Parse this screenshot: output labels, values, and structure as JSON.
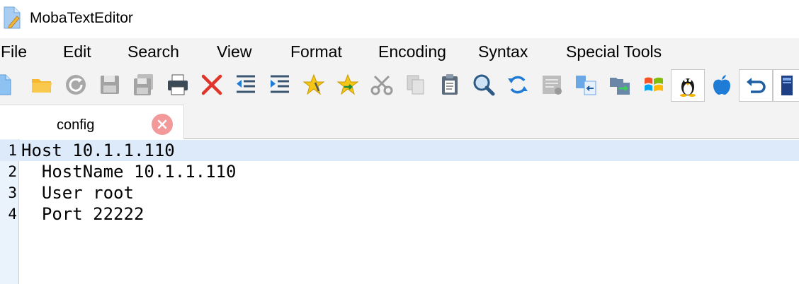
{
  "window": {
    "title": "MobaTextEditor"
  },
  "menu": {
    "items": [
      "File",
      "Edit",
      "Search",
      "View",
      "Format",
      "Encoding",
      "Syntax",
      "Special Tools"
    ]
  },
  "toolbar": {
    "icons": [
      "new-file-icon",
      "open-folder-icon",
      "reload-icon",
      "save-icon",
      "save-all-icon",
      "print-icon",
      "close-red-x-icon",
      "outdent-icon",
      "indent-icon",
      "bookmark-star-clip-icon",
      "bookmark-star-next-icon",
      "cut-scissors-icon",
      "copy-icon",
      "paste-clipboard-icon",
      "find-magnifier-icon",
      "replace-refresh-icon",
      "document-properties-icon",
      "compare-left-icon",
      "compare-right-icon",
      "windows-logo-icon",
      "linux-tux-icon",
      "apple-logo-icon",
      "undo-return-icon",
      "terminal-panel-icon"
    ]
  },
  "tabs": [
    {
      "label": "config",
      "active": true
    }
  ],
  "editor": {
    "lines": [
      {
        "number": "1",
        "text": "Host 10.1.1.110"
      },
      {
        "number": "2",
        "text": "  HostName 10.1.1.110"
      },
      {
        "number": "3",
        "text": "  User root"
      },
      {
        "number": "4",
        "text": "  Port 22222"
      }
    ],
    "current_line": 1
  },
  "colors": {
    "chrome_bg": "#f3f3f3",
    "gutter_bg": "#eaf2fb",
    "current_line_bg": "#ddeafa",
    "tab_close_bg": "#f29a9a",
    "accent_blue": "#1e7bd6"
  }
}
